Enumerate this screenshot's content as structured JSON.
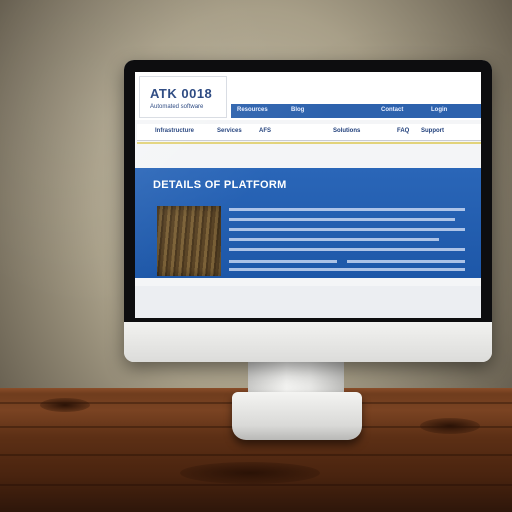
{
  "scene": {
    "objects": [
      "wall",
      "wooden-desk",
      "monitor",
      "monitor-stand"
    ]
  },
  "website": {
    "logo": {
      "title": "ATK 0018",
      "subtitle": "Automated software"
    },
    "nav": [
      "Resources",
      "Blog",
      "Contact",
      "Login"
    ],
    "subnav": [
      "Infrastructure",
      "Services",
      "AFS",
      "Solutions",
      "FAQ",
      "Support"
    ],
    "hero": {
      "heading": "DETAILS OF PLATFORM",
      "accent_color": "#2a66b8"
    }
  },
  "colors": {
    "brand_blue": "#2a66b8",
    "nav_blue": "#2d62ad",
    "logo_text": "#1f3e7a",
    "accent_yellow": "#e2d37a",
    "desk_wood": "#6b3a1c",
    "monitor_frame": "#f4f4f2"
  }
}
